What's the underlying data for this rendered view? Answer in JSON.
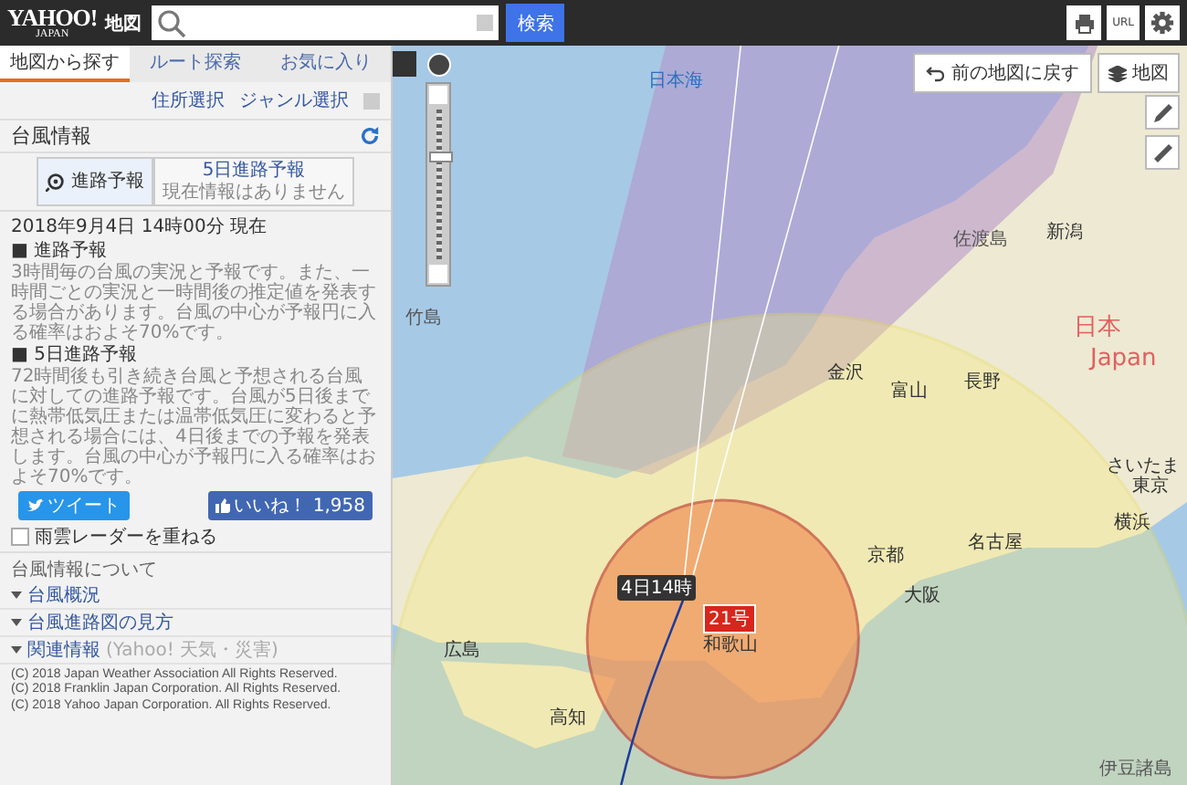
{
  "header": {
    "logo": "YAHOO!",
    "logo_sub": "JAPAN",
    "service": "地図",
    "search_button": "検索",
    "tools": [
      {
        "kind": "print"
      },
      {
        "kind": "text",
        "label": "URL"
      },
      {
        "kind": "settings"
      }
    ]
  },
  "sidebar": {
    "tabs": [
      {
        "label": "地図から探す",
        "selected": true
      },
      {
        "label": "ルート探索",
        "selected": false
      },
      {
        "label": "お気に入り",
        "selected": false
      }
    ],
    "links": [
      "住所選択",
      "ジャンル選択"
    ],
    "title": "台風情報",
    "forecast_tabs": [
      {
        "label": "進路予報",
        "selected": true
      },
      {
        "label": "5日進路予報",
        "sub": "現在情報はありません",
        "selected": false
      }
    ],
    "timestamp": "2018年9月4日 14時00分 現在",
    "sections": [
      {
        "heading": "■ 進路予報",
        "text": "3時間毎の台風の実況と予報です。また、一時間ごとの実況と一時間後の推定値を発表する場合があります。台風の中心が予報円に入る確率はおよそ70%です。"
      },
      {
        "heading": "■ 5日進路予報",
        "text": "72時間後も引き続き台風と予想される台風に対しての進路予報です。台風が5日後までに熱帯低気圧または温帯低気圧に変わると予想される場合には、4日後までの予報を発表します。台風の中心が予報円に入る確率はおよそ70%です。"
      }
    ],
    "tweet": "ツイート",
    "like": "いいね！",
    "like_count": "1,958",
    "radar_overlay": {
      "label": "雨雲レーダーを重ねる",
      "checked": false
    },
    "about_title": "台風情報について",
    "about_items": [
      {
        "label": "台風概況"
      },
      {
        "label": "台風進路図の見方"
      },
      {
        "label": "関連情報",
        "note": "(Yahoo! 天気・災害)"
      }
    ],
    "copyright": [
      "(C) 2018 Japan Weather Association All Rights Reserved.",
      "(C) 2018 Franklin Japan Corporation. All Rights Reserved.",
      "(C) 2018 Yahoo Japan Corporation. All Rights Reserved."
    ]
  },
  "map": {
    "back_button": "前の地図に戻す",
    "layer_button": "地図",
    "zoom": {
      "level": 0.68
    },
    "labels": [
      {
        "text": "日本海",
        "kind": "sea"
      },
      {
        "text": "佐渡島",
        "kind": "place"
      },
      {
        "text": "新潟",
        "kind": "city"
      },
      {
        "text": "日本",
        "kind": "country"
      },
      {
        "text": "Japan",
        "kind": "country"
      },
      {
        "text": "金沢",
        "kind": "city"
      },
      {
        "text": "富山",
        "kind": "city"
      },
      {
        "text": "長野",
        "kind": "city"
      },
      {
        "text": "竹島",
        "kind": "place"
      },
      {
        "text": "京都",
        "kind": "city"
      },
      {
        "text": "大阪",
        "kind": "city"
      },
      {
        "text": "名古屋",
        "kind": "city"
      },
      {
        "text": "さいたま",
        "kind": "city"
      },
      {
        "text": "東京",
        "kind": "city"
      },
      {
        "text": "横浜",
        "kind": "city"
      },
      {
        "text": "広島",
        "kind": "city"
      },
      {
        "text": "高知",
        "kind": "city"
      },
      {
        "text": "和歌山",
        "kind": "city"
      },
      {
        "text": "伊豆諸島",
        "kind": "place"
      }
    ],
    "typhoon": {
      "name": "21号",
      "time": "4日14時"
    }
  }
}
